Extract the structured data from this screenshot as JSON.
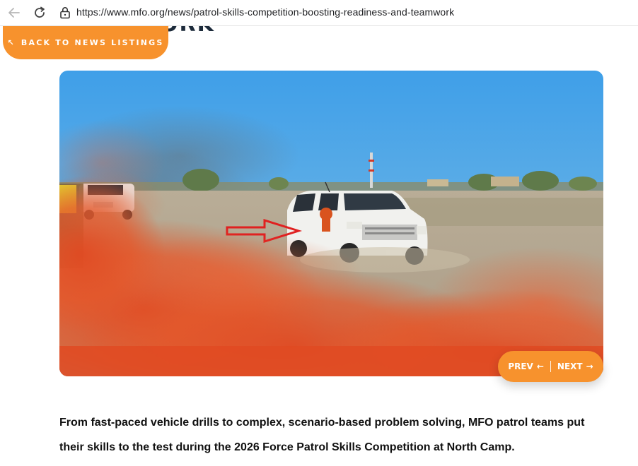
{
  "browser": {
    "url": "https://www.mfo.org/news/patrol-skills-competition-boosting-readiness-and-teamwork"
  },
  "page": {
    "cut_title": "ORK",
    "back_link": {
      "arrow": "↖",
      "label": "BACK TO NEWS LISTINGS"
    },
    "pager": {
      "prev_label": "PREV",
      "prev_arrow": "←",
      "next_label": "NEXT",
      "next_arrow": "→"
    },
    "intro": "From fast-paced vehicle drills to complex, scenario-based problem solving, MFO patrol teams put their skills to the test during the 2026 Force Patrol Skills Competition at North Camp."
  },
  "colors": {
    "accent": "#f7922d",
    "smoke": "#e4572a",
    "sky": "#4aa3e6",
    "arrow": "#e02020"
  }
}
